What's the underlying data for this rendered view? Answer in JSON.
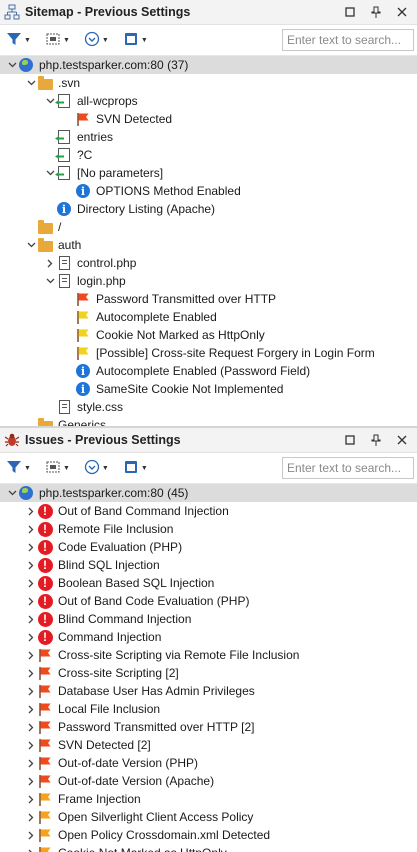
{
  "sitemap": {
    "title": "Sitemap - Previous Settings",
    "search_placeholder": "Enter text to search...",
    "rows": [
      {
        "depth": 0,
        "expand": "open",
        "icon": "globe-icon",
        "label": "php.testsparker.com:80 (37)",
        "selected": true
      },
      {
        "depth": 1,
        "expand": "open",
        "icon": "folder-icon",
        "label": ".svn"
      },
      {
        "depth": 2,
        "expand": "open",
        "icon": "param-file-icon",
        "label": "all-wcprops"
      },
      {
        "depth": 3,
        "expand": "none",
        "icon": "red-flag-icon",
        "label": "SVN Detected"
      },
      {
        "depth": 2,
        "expand": "none",
        "icon": "param-file-icon",
        "label": "entries"
      },
      {
        "depth": 2,
        "expand": "none",
        "icon": "param-file-icon",
        "label": "?C"
      },
      {
        "depth": 2,
        "expand": "open",
        "icon": "param-file-icon",
        "label": "[No parameters]"
      },
      {
        "depth": 3,
        "expand": "none",
        "icon": "info-icon",
        "label": "OPTIONS Method Enabled"
      },
      {
        "depth": 2,
        "expand": "none",
        "icon": "info-icon",
        "label": "Directory Listing (Apache)"
      },
      {
        "depth": 1,
        "expand": "none",
        "icon": "folder-icon",
        "label": "/"
      },
      {
        "depth": 1,
        "expand": "open",
        "icon": "folder-icon",
        "label": "auth"
      },
      {
        "depth": 2,
        "expand": "closed",
        "icon": "file-icon",
        "label": "control.php"
      },
      {
        "depth": 2,
        "expand": "open",
        "icon": "file-icon",
        "label": "login.php"
      },
      {
        "depth": 3,
        "expand": "none",
        "icon": "red-flag-icon",
        "label": "Password Transmitted over HTTP"
      },
      {
        "depth": 3,
        "expand": "none",
        "icon": "yellow-flag-icon",
        "label": "Autocomplete Enabled"
      },
      {
        "depth": 3,
        "expand": "none",
        "icon": "yellow-flag-icon",
        "label": "Cookie Not Marked as HttpOnly"
      },
      {
        "depth": 3,
        "expand": "none",
        "icon": "yellow-flag-icon",
        "label": "[Possible] Cross-site Request Forgery in Login Form"
      },
      {
        "depth": 3,
        "expand": "none",
        "icon": "info-icon",
        "label": "Autocomplete Enabled (Password Field)"
      },
      {
        "depth": 3,
        "expand": "none",
        "icon": "info-icon",
        "label": "SameSite Cookie Not Implemented"
      },
      {
        "depth": 2,
        "expand": "none",
        "icon": "file-icon",
        "label": "style.css"
      },
      {
        "depth": 1,
        "expand": "none",
        "icon": "folder-icon",
        "label": "Generics"
      }
    ]
  },
  "issues": {
    "title": "Issues - Previous Settings",
    "search_placeholder": "Enter text to search...",
    "rows": [
      {
        "depth": 0,
        "expand": "open",
        "icon": "globe-icon",
        "label": "php.testsparker.com:80 (45)",
        "selected": true
      },
      {
        "depth": 1,
        "expand": "closed",
        "icon": "critical-icon",
        "label": "Out of Band Command Injection"
      },
      {
        "depth": 1,
        "expand": "closed",
        "icon": "critical-icon",
        "label": "Remote File Inclusion"
      },
      {
        "depth": 1,
        "expand": "closed",
        "icon": "critical-icon",
        "label": "Code Evaluation (PHP)"
      },
      {
        "depth": 1,
        "expand": "closed",
        "icon": "critical-icon",
        "label": "Blind SQL Injection"
      },
      {
        "depth": 1,
        "expand": "closed",
        "icon": "critical-icon",
        "label": "Boolean Based SQL Injection"
      },
      {
        "depth": 1,
        "expand": "closed",
        "icon": "critical-icon",
        "label": "Out of Band Code Evaluation (PHP)"
      },
      {
        "depth": 1,
        "expand": "closed",
        "icon": "critical-icon",
        "label": "Blind Command Injection"
      },
      {
        "depth": 1,
        "expand": "closed",
        "icon": "critical-icon",
        "label": "Command Injection"
      },
      {
        "depth": 1,
        "expand": "closed",
        "icon": "red-flag-icon",
        "label": "Cross-site Scripting via Remote File Inclusion"
      },
      {
        "depth": 1,
        "expand": "closed",
        "icon": "red-flag-icon",
        "label": "Cross-site Scripting [2]"
      },
      {
        "depth": 1,
        "expand": "closed",
        "icon": "red-flag-icon",
        "label": "Database User Has Admin Privileges"
      },
      {
        "depth": 1,
        "expand": "closed",
        "icon": "red-flag-icon",
        "label": "Local File Inclusion"
      },
      {
        "depth": 1,
        "expand": "closed",
        "icon": "red-flag-icon",
        "label": "Password Transmitted over HTTP [2]"
      },
      {
        "depth": 1,
        "expand": "closed",
        "icon": "red-flag-icon",
        "label": "SVN Detected [2]"
      },
      {
        "depth": 1,
        "expand": "closed",
        "icon": "red-flag-icon",
        "label": "Out-of-date Version (PHP)"
      },
      {
        "depth": 1,
        "expand": "closed",
        "icon": "red-flag-icon",
        "label": "Out-of-date Version (Apache)"
      },
      {
        "depth": 1,
        "expand": "closed",
        "icon": "orange-flag-icon",
        "label": "Frame Injection"
      },
      {
        "depth": 1,
        "expand": "closed",
        "icon": "orange-flag-icon",
        "label": "Open Silverlight Client Access Policy"
      },
      {
        "depth": 1,
        "expand": "closed",
        "icon": "orange-flag-icon",
        "label": "Open Policy Crossdomain.xml Detected"
      },
      {
        "depth": 1,
        "expand": "closed",
        "icon": "orange-flag-icon",
        "label": "Cookie Not Marked as HttpOnly"
      }
    ]
  },
  "colors": {
    "critical": "#e31b23",
    "high_flag": "#f04a1c",
    "medium_flag": "#f5a31a",
    "low_flag": "#f2d21b",
    "info": "#1e74d8",
    "folder": "#e8a93a",
    "selected_row": "#dcdcdc"
  }
}
